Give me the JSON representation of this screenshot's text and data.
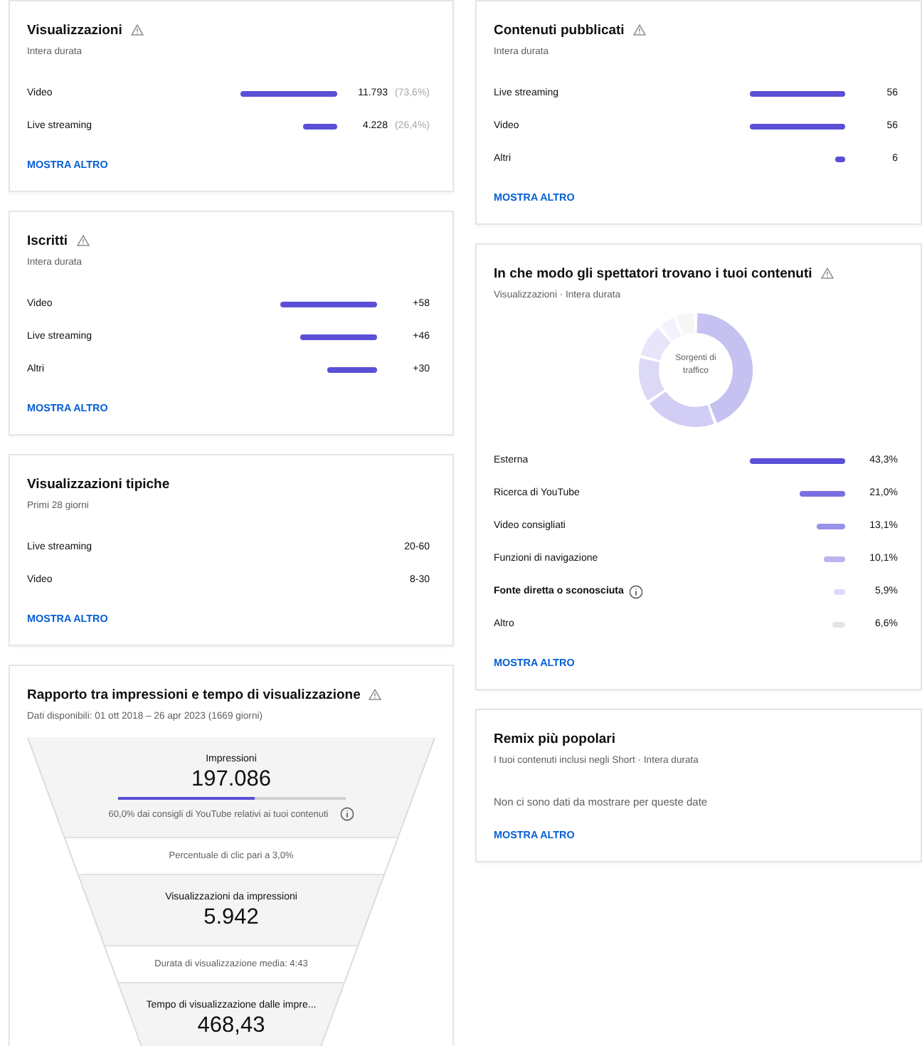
{
  "left_column": [
    {
      "kind": "bars",
      "title": "Visualizzazioni",
      "warning": true,
      "subtitle": "Intera durata",
      "rows": [
        {
          "label": "Video",
          "value": "11.793",
          "share": "(73,6%)"
        },
        {
          "label": "Live streaming",
          "value": "4.228",
          "share": "(26,4%)"
        }
      ],
      "link": "MOSTRA ALTRO"
    },
    {
      "kind": "bars",
      "title": "Iscritti",
      "warning": true,
      "subtitle": "Intera durata",
      "rows": [
        {
          "label": "Video",
          "value": "+58"
        },
        {
          "label": "Live streaming",
          "value": "+46"
        },
        {
          "label": "Altri",
          "value": "+30"
        }
      ],
      "link": "MOSTRA ALTRO"
    },
    {
      "kind": "ranges",
      "title": "Visualizzazioni tipiche",
      "warning": false,
      "subtitle": "Primi 28 giorni",
      "rows": [
        {
          "label": "Live streaming",
          "value": "20-60"
        },
        {
          "label": "Video",
          "value": "8-30"
        }
      ],
      "link": "MOSTRA ALTRO"
    },
    {
      "kind": "funnel",
      "title": "Rapporto tra impressioni e tempo di visualizzazione",
      "warning": true,
      "subtitle": "Dati disponibili: 01 ott 2018 – 26 apr 2023 (1669 giorni)",
      "stages": [
        {
          "kind": "metric",
          "label": "Impressioni",
          "value": "197.086",
          "level": 0.6,
          "note": "60,0% dai consigli di YouTube relativi ai tuoi contenuti"
        },
        {
          "kind": "ratio",
          "text": "Percentuale di clic pari a 3,0%"
        },
        {
          "kind": "metric",
          "label": "Visualizzazioni da impressioni",
          "value": "5.942"
        },
        {
          "kind": "ratio",
          "text": "Durata di visualizzazione media: 4:43"
        },
        {
          "kind": "metric",
          "label": "Tempo di visualizzazione dalle impre...",
          "value": "468,43"
        }
      ]
    }
  ],
  "right_column": [
    {
      "kind": "bars",
      "title": "Contenuti pubblicati",
      "warning": true,
      "subtitle": "Intera durata",
      "rows": [
        {
          "label": "Live streaming",
          "value": "56"
        },
        {
          "label": "Video",
          "value": "56"
        },
        {
          "label": "Altri",
          "value": "6"
        }
      ],
      "link": "MOSTRA ALTRO"
    },
    {
      "kind": "traffic",
      "title": "In che modo gli spettatori trovano i tuoi contenuti",
      "warning": true,
      "subtitle": "Visualizzazioni · Intera durata",
      "donut_label": "Sorgenti di traffico",
      "rows": [
        {
          "label": "Esterna",
          "value": "43,3%",
          "color": "#5a4fd6",
          "info": false
        },
        {
          "label": "Ricerca di YouTube",
          "value": "21,0%",
          "color": "#7a6fe0",
          "info": false
        },
        {
          "label": "Video consigliati",
          "value": "13,1%",
          "color": "#9a91e8",
          "info": false
        },
        {
          "label": "Funzioni di navigazione",
          "value": "10,1%",
          "color": "#bab4f0",
          "info": false
        },
        {
          "label": "Fonte diretta o sconosciuta",
          "value": "5,9%",
          "color": "#dcd9f8",
          "info": true
        },
        {
          "label": "Altro",
          "value": "6,6%",
          "color": "#e4e4e4",
          "info": false
        }
      ],
      "link": "MOSTRA ALTRO"
    },
    {
      "kind": "empty",
      "title": "Remix più popolari",
      "warning": false,
      "subtitle": "I tuoi contenuti inclusi negli Short · Intera durata",
      "message": "Non ci sono dati da mostrare per queste date",
      "link": "MOSTRA ALTRO"
    }
  ]
}
